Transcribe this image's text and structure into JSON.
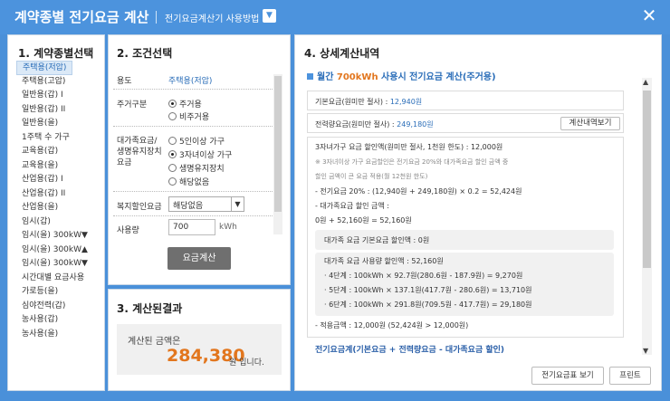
{
  "header": {
    "title": "계약종별 전기요금 계산",
    "help_link": "전기요금계산기 사용방법"
  },
  "panel1": {
    "heading": "1. 계약종별선택",
    "items": [
      "주택용(저압)",
      "주택용(고압)",
      "일반용(갑) I",
      "일반용(갑) II",
      "일반용(을)",
      "1주택 수 가구",
      "교육용(갑)",
      "교육용(을)",
      "산업용(갑) I",
      "산업용(갑) II",
      "산업용(을)",
      "임시(갑)",
      "임시(을) 300kW▼",
      "임시(을) 300kW▲",
      "임시(을) 300kW▼",
      "시간대별 요금사용",
      "가로등(을)",
      "심야전력(갑)",
      "농사용(갑)",
      "농사용(을)"
    ],
    "selected_index": 0
  },
  "panel2": {
    "heading": "2. 조건선택",
    "usage_label": "용도",
    "usage_value": "주택용(저압)",
    "residence_label": "주거구분",
    "residence_options": [
      "주거용",
      "비주거용"
    ],
    "family_label": "대가족요금/ 생명유지장치 요금",
    "family_options": [
      "5인이상 가구",
      "3자녀이상 가구",
      "생명유지장치",
      "해당없음"
    ],
    "welfare_label": "복지할인요금",
    "welfare_value": "해당없음",
    "amount_label": "사용량",
    "amount_value": "700",
    "amount_unit": "kWh",
    "calc_button": "요금계산"
  },
  "panel3": {
    "heading": "3. 계산된결과",
    "result_label": "계산된 금액은",
    "result_value": "284,380",
    "result_suffix": "원 입니다."
  },
  "panel4": {
    "heading": "4. 상세계산내역",
    "summary_prefix": "월간 ",
    "summary_usage": "700kWh",
    "summary_suffix": " 사용시 전기요금 계산(주거용)",
    "base_label": "기본요금(원미만 절사) : ",
    "base_value": "12,940원",
    "energy_label": "전력량요금(원미만 절사) : ",
    "energy_value": "249,180원",
    "detail_button": "계산내역보기",
    "discount_title": "3자녀가구 요금 할인액(원미만 절사, 1천원 한도) : 12,000원",
    "discount_note1": "※ 3자녀이상 가구 요금할인은 전기요금 20%와 대가족요금 할인 금액 중",
    "discount_note2": "할인 금액이 큰 요금 적용(월 12천원 한도)",
    "calc_line1": "- 전기요금 20% : (12,940원 + 249,180원) × 0.2 = 52,424원",
    "calc_line2": "- 대가족요금 할인 금액 :",
    "calc_line3": "0원 + 52,160원 = 52,160원",
    "basic_discount": "대가족 요금 기본요금 할인액 : 0원",
    "usage_discount_title": "대가족 요금 사용량 할인액 : 52,160원",
    "tier4": "· 4단계 : 100kWh × 92.7원(280.6원 - 187.9원) = 9,270원",
    "tier5": "· 5단계 : 100kWh × 137.1원(417.7원 - 280.6원) = 13,710원",
    "tier6": "· 6단계 : 100kWh × 291.8원(709.5원 - 417.7원) = 29,180원",
    "applied": "- 적용금액 : 12,000원 (52,424원 > 12,000원)",
    "total_heading": "전기요금계(기본요금 + 전력량요금 - 대가족요금 할인)",
    "footer_btn1": "전기요금표 보기",
    "footer_btn2": "프린트"
  }
}
